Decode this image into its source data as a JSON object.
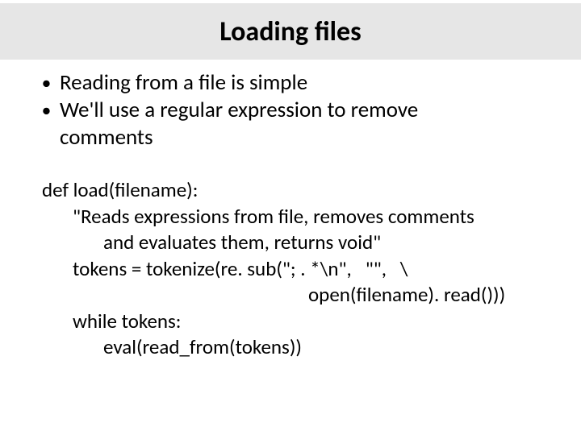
{
  "title": "Loading files",
  "bullets": [
    "Reading from a file is simple",
    "We'll use a regular expression to remove",
    "comments"
  ],
  "bullet_is_continuation": [
    false,
    false,
    true
  ],
  "code": {
    "l0": "def load(filename):",
    "l1": "\"Reads expressions from file, removes comments",
    "l2": "and evaluates them, returns void\"",
    "l3": "tokens = tokenize(re. sub(\"; . *\\n\",   \"\",   \\",
    "l4": "open(filename). read()))",
    "l5": "while tokens:",
    "l6": "eval(read_from(tokens))"
  }
}
